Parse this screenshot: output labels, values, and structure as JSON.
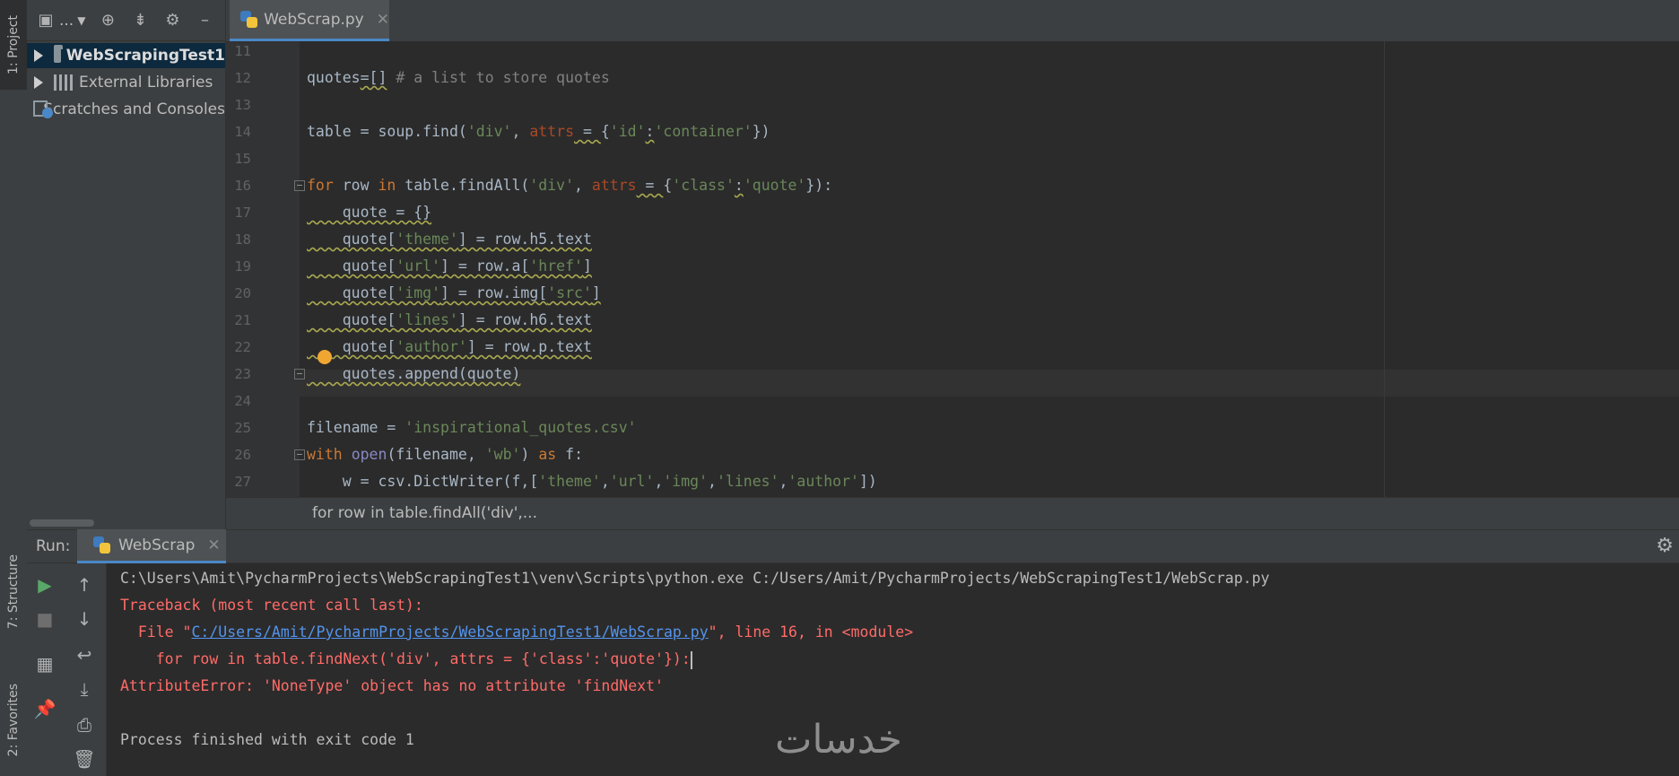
{
  "left_strip": {
    "tab_project": "1: Project",
    "tab_structure": "7: Structure",
    "tab_favorites": "2: Favorites"
  },
  "project": {
    "toolbar_dropdown": "...",
    "tree": [
      {
        "label": "WebScrapingTest1",
        "selected": true,
        "type": "folder"
      },
      {
        "label": "External Libraries",
        "selected": false,
        "type": "library"
      },
      {
        "label": "Scratches and Consoles",
        "selected": false,
        "type": "scratches"
      }
    ]
  },
  "editor": {
    "tab_label": "WebScrap.py",
    "breadcrumb": "for row in table.findAll('div',...",
    "lines": [
      {
        "n": "11",
        "html": ""
      },
      {
        "n": "12",
        "html": "quotes<span class='wavy'>=[]</span> <span class='cm'># a list to store quotes</span>"
      },
      {
        "n": "13",
        "html": ""
      },
      {
        "n": "14",
        "html": "table = soup.find(<span class='str'>'div'</span>, <span class='kwarg'>attrs</span><span class='wavy'> = </span>{<span class='str'>'id'</span><span class='wavy'>:</span><span class='str'>'container'</span>})"
      },
      {
        "n": "15",
        "html": ""
      },
      {
        "n": "16",
        "html": "<span class='kw'>for</span> row <span class='kw'>in</span> table.findAll(<span class='str'>'div'</span>, <span class='kwarg'>attrs</span><span class='wavy'> = </span>{<span class='str'>'class'</span><span class='wavy'>:</span><span class='str'>'quote'</span>}):"
      },
      {
        "n": "17",
        "html": "<span class='wavy'>    quote = {}</span>"
      },
      {
        "n": "18",
        "html": "<span class='wavy'>    quote[<span class='str'>'theme'</span>] = row.h5.text</span>"
      },
      {
        "n": "19",
        "html": "<span class='wavy'>    quote[<span class='str'>'url'</span>] = row.a[<span class='str'>'href'</span>]</span>"
      },
      {
        "n": "20",
        "html": "<span class='wavy'>    quote[<span class='str'>'img'</span>] = row.img[<span class='str'>'src'</span>]</span>"
      },
      {
        "n": "21",
        "html": "<span class='wavy'>    quote[<span class='str'>'lines'</span>] = row.h6.text</span>"
      },
      {
        "n": "22",
        "html": "<span class='wavy'>    quote[<span class='str'>'author'</span>] = row.p.text</span>"
      },
      {
        "n": "23",
        "html": "<span class='wavy'>    quotes.append(quote)</span>"
      },
      {
        "n": "24",
        "html": ""
      },
      {
        "n": "25",
        "html": "filename = <span class='str'>'inspirational_quotes.csv'</span>"
      },
      {
        "n": "26",
        "html": "<span class='kw'>with</span> <span class='builtin'>open</span>(filename, <span class='str'>'wb'</span>) <span class='kw'>as</span> f:"
      },
      {
        "n": "27",
        "html": "    w = csv.DictWriter(f,[<span class='str'>'theme'</span>,<span class='str'>'url'</span>,<span class='str'>'img'</span>,<span class='str'>'lines'</span>,<span class='str'>'author'</span>])"
      }
    ]
  },
  "run": {
    "label": "Run:",
    "tab_label": "WebScrap",
    "console": {
      "cmd": "C:\\Users\\Amit\\PycharmProjects\\WebScrapingTest1\\venv\\Scripts\\python.exe C:/Users/Amit/PycharmProjects/WebScrapingTest1/WebScrap.py",
      "traceback": "Traceback (most recent call last):",
      "file_prefix": "  File \"",
      "file_link": "C:/Users/Amit/PycharmProjects/WebScrapingTest1/WebScrap.py",
      "file_suffix": "\", line 16, in <module>",
      "code_line": "    for row in table.findNext('div', attrs = {'class':'quote'}):",
      "error": "AttributeError: 'NoneType' object has no attribute 'findNext'",
      "exit": "Process finished with exit code 1"
    }
  },
  "watermark": "خدسات"
}
